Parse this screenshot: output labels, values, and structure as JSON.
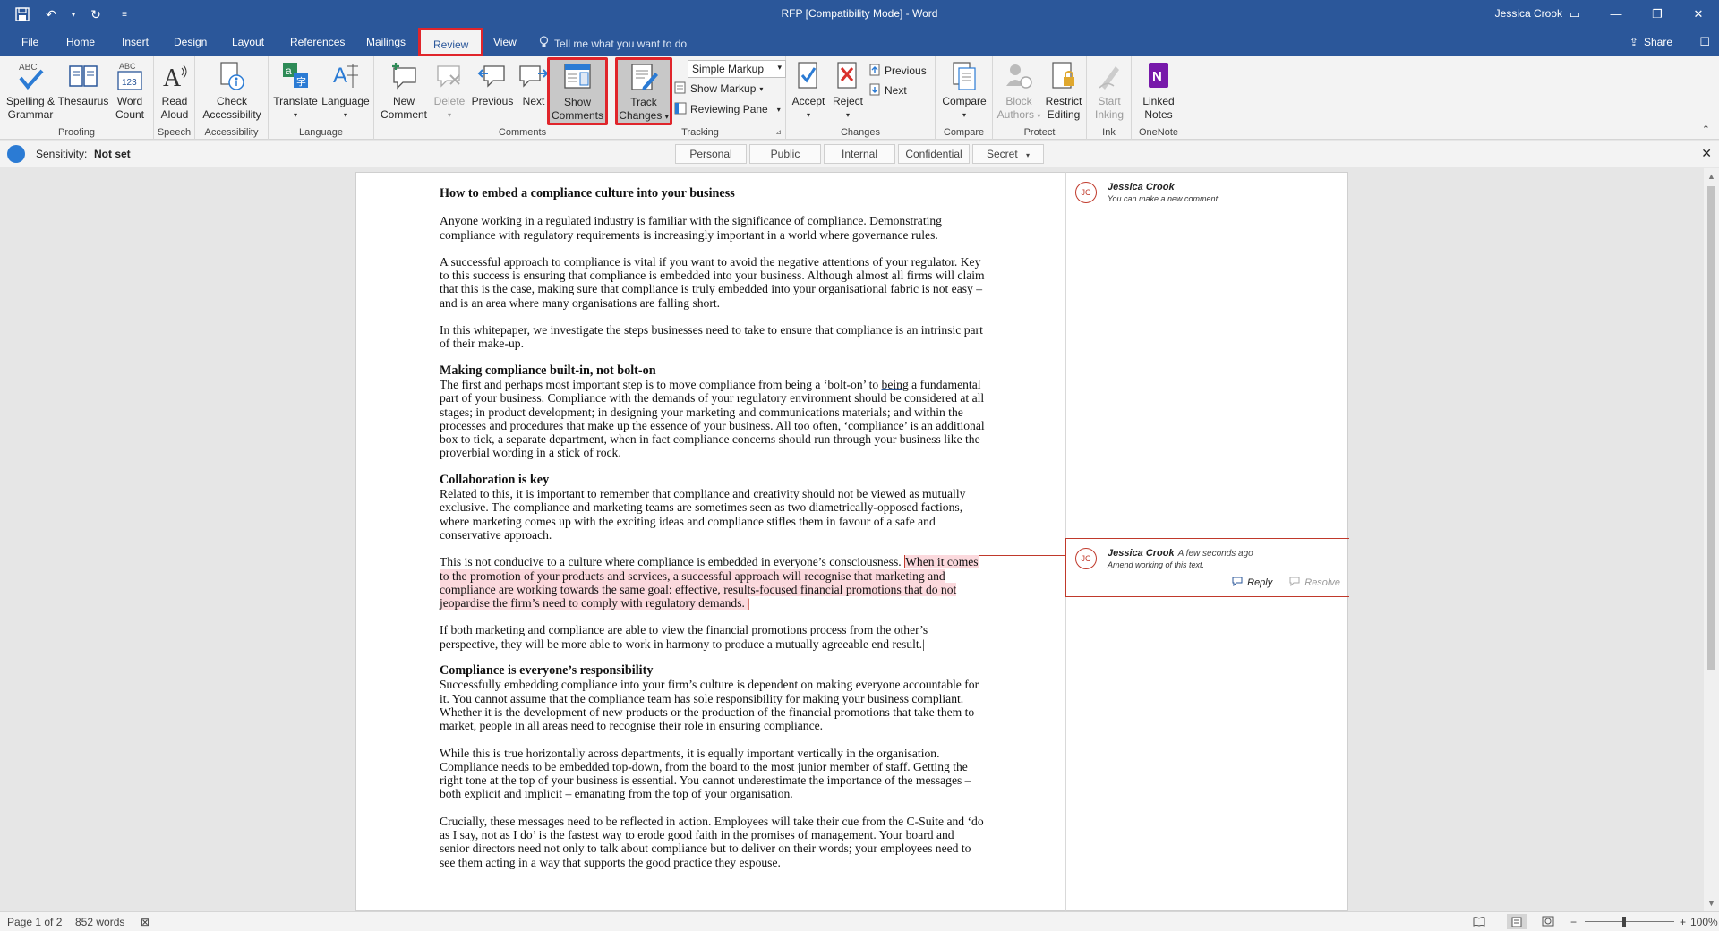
{
  "titlebar": {
    "title": "RFP [Compatibility Mode]  -  Word",
    "user": "Jessica Crook"
  },
  "tabs": [
    "File",
    "Home",
    "Insert",
    "Design",
    "Layout",
    "References",
    "Mailings",
    "Review",
    "View"
  ],
  "active_tab": "Review",
  "tellme": "Tell me what you want to do",
  "share": "Share",
  "ribbon": {
    "proofing": {
      "spelling": "Spelling &",
      "spelling2": "Grammar",
      "thesaurus": "Thesaurus",
      "wordcount": "Word",
      "wordcount2": "Count",
      "label": "Proofing"
    },
    "speech": {
      "read": "Read",
      "read2": "Aloud",
      "label": "Speech"
    },
    "accessibility": {
      "check": "Check",
      "check2": "Accessibility",
      "label": "Accessibility"
    },
    "language": {
      "translate": "Translate",
      "language": "Language",
      "label": "Language"
    },
    "comments": {
      "new": "New",
      "new2": "Comment",
      "delete": "Delete",
      "previous": "Previous",
      "next": "Next",
      "show": "Show",
      "show2": "Comments",
      "label": "Comments"
    },
    "tracking": {
      "track": "Track",
      "track2": "Changes",
      "markup_select": "Simple Markup",
      "show_markup": "Show Markup",
      "reviewing_pane": "Reviewing Pane",
      "label": "Tracking"
    },
    "changes": {
      "accept": "Accept",
      "reject": "Reject",
      "previous": "Previous",
      "next": "Next",
      "label": "Changes"
    },
    "compare": {
      "compare": "Compare",
      "label": "Compare"
    },
    "protect": {
      "block": "Block",
      "block2": "Authors",
      "restrict": "Restrict",
      "restrict2": "Editing",
      "label": "Protect"
    },
    "ink": {
      "start": "Start",
      "start2": "Inking",
      "label": "Ink"
    },
    "onenote": {
      "linked": "Linked",
      "linked2": "Notes",
      "label": "OneNote"
    }
  },
  "sensitivity": {
    "label": "Sensitivity:",
    "value": "Not set",
    "options": [
      "Personal",
      "Public",
      "Internal",
      "Confidential",
      "Secret"
    ]
  },
  "document": {
    "heading": "How to embed a compliance culture into your business",
    "p1": "Anyone working in a regulated industry is familiar with the significance of compliance. Demonstrating compliance with regulatory requirements is increasingly important in a world where governance rules.",
    "p2": "A successful approach to compliance is vital if you want to avoid the negative attentions of your regulator.  Key to this success is ensuring that compliance is embedded into your business. Although almost all firms will claim that this is the case, making sure that compliance is truly embedded into your organisational fabric is not easy – and is an area where many organisations are falling short.",
    "p3": "In this whitepaper, we investigate the steps businesses need to take to ensure that compliance is an intrinsic part of their make-up.",
    "h2": "Making compliance built-in, not bolt-on",
    "p4a": "The first and perhaps most important step is to move compliance from being a ‘bolt-on’ to ",
    "p4u": "being",
    "p4b": " a fundamental part of your business. Compliance with the demands of your regulatory environment should be considered at all stages; in product development; in designing your marketing and communications materials; and within the processes and procedures that make up the essence of your business. All too often, ‘compliance’ is an additional box to tick, a separate department, when in fact compliance concerns should run through your business like the proverbial wording in a stick of rock.",
    "h3": "Collaboration is key",
    "p5": "Related to this, it is important to remember that compliance and creativity should not be viewed as mutually exclusive.  The compliance and marketing teams are sometimes seen as two diametrically-opposed factions, where marketing comes up with the exciting ideas and compliance stifles them in favour of a safe and conservative approach.",
    "p6a": "This is not conducive to a culture where compliance is embedded in everyone’s consciousness. ",
    "p6b": "When it comes to the promotion of your products and services, a successful approach will recognise that marketing and compliance are working towards the same goal: effective, results-focused financial promotions that do not jeopardise the firm’s need to comply with regulatory demands. ",
    "p7": "If both marketing and compliance are able to view the financial promotions process from the other’s perspective, they will be more able to work in harmony to produce a mutually agreeable end result.",
    "h4": "Compliance is everyone’s responsibility",
    "p8": "Successfully embedding compliance into your firm’s culture is dependent on making everyone accountable for it. You cannot assume that the compliance team has sole responsibility for making your business compliant. Whether it is the development of new products or the production of the financial promotions that take them to market, people in all areas need to recognise their role in ensuring compliance.",
    "p9": "While this is true horizontally across departments, it is equally important vertically in the organisation. Compliance needs to be embedded top-down, from the board to the most junior member of staff. Getting the right tone at the top of your business is essential.  You cannot underestimate the importance of the messages – both explicit and implicit – emanating from the top of your organisation.",
    "p10": "Crucially, these messages need to be reflected in action. Employees will take their cue from the C-Suite and ‘do as I say, not as I do’ is the fastest way to erode good faith in the promises of management. Your board and senior directors need not only to talk about compliance but to deliver on their words; your employees need to see them acting in a way that supports the good practice they espouse."
  },
  "comments": [
    {
      "initials": "JC",
      "author": "Jessica Crook",
      "time": "",
      "text": "You can make a new comment."
    },
    {
      "initials": "JC",
      "author": "Jessica Crook",
      "time": "A few seconds ago",
      "text": "Amend working of this text.",
      "reply": "Reply",
      "resolve": "Resolve"
    }
  ],
  "statusbar": {
    "page": "Page 1 of 2",
    "words": "852 words",
    "zoom": "100%"
  },
  "colors": {
    "brand": "#2b579a",
    "highlight": "#e0252b",
    "comment": "#c0392b"
  }
}
